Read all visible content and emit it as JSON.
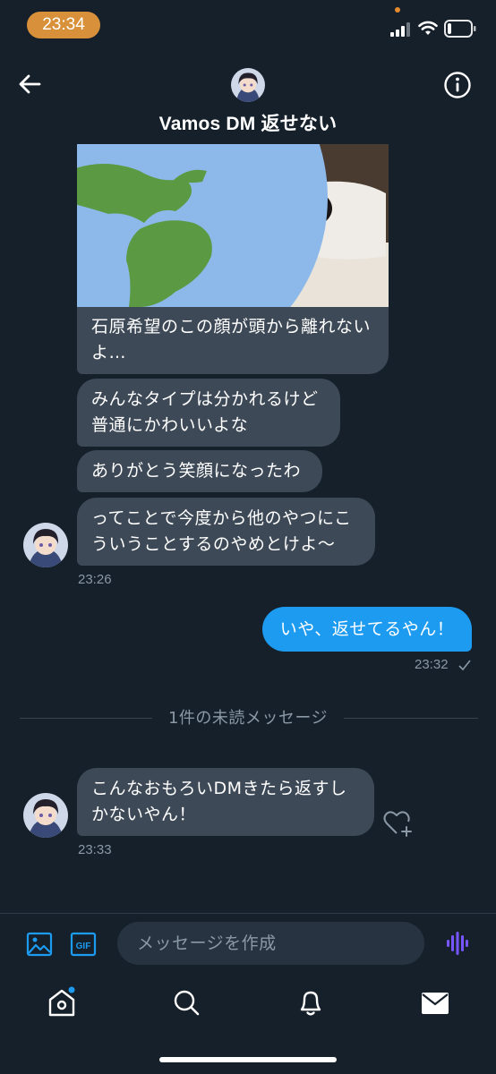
{
  "status_bar": {
    "time": "23:34"
  },
  "header": {
    "title": "Vamos DM 返せない"
  },
  "messages": {
    "received_1": "石原希望のこの顔が頭から離れないよ…",
    "received_2": "みんなタイプは分かれるけど普通にかわいいよな",
    "received_3": "ありがとう笑顔になったわ",
    "received_4": "ってことで今度から他のやつにこういうことするのやめとけよ～",
    "received_time_1": "23:26",
    "sent_1": "いや、返せてるやん！",
    "sent_time_1": "23:32",
    "unread_divider": "1件の未読メッセージ",
    "received_5": "こんなおもろいDMきたら返すしかないやん！",
    "received_time_2": "23:33"
  },
  "composer": {
    "placeholder": "メッセージを作成"
  },
  "colors": {
    "background": "#15202b",
    "bubble_received": "#3d4956",
    "bubble_sent": "#1d9bf0",
    "accent_purple": "#7856ff",
    "status_pill": "#d8913a"
  },
  "icons": [
    "back-arrow-icon",
    "info-icon",
    "image-icon",
    "gif-icon",
    "voice-icon",
    "home-icon",
    "search-icon",
    "bell-icon",
    "mail-icon",
    "heart-add-icon",
    "check-icon"
  ]
}
